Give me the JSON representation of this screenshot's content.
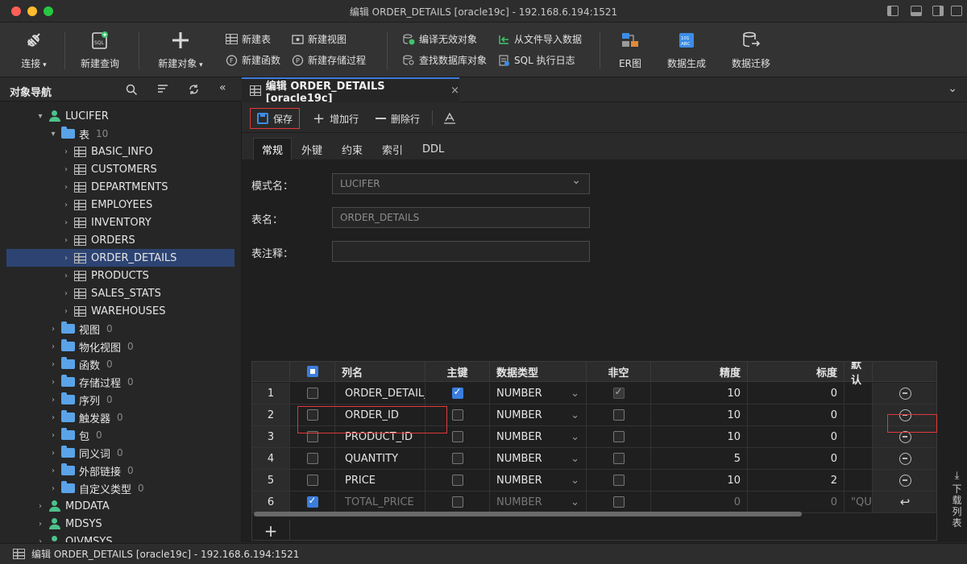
{
  "window": {
    "title": "编辑 ORDER_DETAILS [oracle19c] - 192.168.6.194:1521"
  },
  "toolbar": {
    "connect": "连接",
    "new_query": "新建查询",
    "new_object": "新建对象",
    "new_table": "新建表",
    "new_view": "新建视图",
    "new_function": "新建函数",
    "new_procedure": "新建存储过程",
    "compile_invalid": "编译无效对象",
    "find_db_object": "查找数据库对象",
    "import_from_file": "从文件导入数据",
    "sql_log": "SQL 执行日志",
    "er": "ER图",
    "data_gen": "数据生成",
    "data_migrate": "数据迁移"
  },
  "nav": {
    "title": "对象导航",
    "tree": [
      {
        "label": "LUCIFER",
        "type": "schema",
        "level": 0,
        "expanded": true
      },
      {
        "label": "表",
        "type": "folder",
        "level": 1,
        "count": "10",
        "expanded": true
      },
      {
        "label": "BASIC_INFO",
        "type": "table",
        "level": 2
      },
      {
        "label": "CUSTOMERS",
        "type": "table",
        "level": 2
      },
      {
        "label": "DEPARTMENTS",
        "type": "table",
        "level": 2
      },
      {
        "label": "EMPLOYEES",
        "type": "table",
        "level": 2
      },
      {
        "label": "INVENTORY",
        "type": "table",
        "level": 2
      },
      {
        "label": "ORDERS",
        "type": "table",
        "level": 2
      },
      {
        "label": "ORDER_DETAILS",
        "type": "table",
        "level": 2,
        "selected": true
      },
      {
        "label": "PRODUCTS",
        "type": "table",
        "level": 2
      },
      {
        "label": "SALES_STATS",
        "type": "table",
        "level": 2
      },
      {
        "label": "WAREHOUSES",
        "type": "table",
        "level": 2
      },
      {
        "label": "视图",
        "type": "folder",
        "level": 1,
        "count": "0"
      },
      {
        "label": "物化视图",
        "type": "folder",
        "level": 1,
        "count": "0"
      },
      {
        "label": "函数",
        "type": "folder",
        "level": 1,
        "count": "0"
      },
      {
        "label": "存储过程",
        "type": "folder",
        "level": 1,
        "count": "0"
      },
      {
        "label": "序列",
        "type": "folder",
        "level": 1,
        "count": "0"
      },
      {
        "label": "触发器",
        "type": "folder",
        "level": 1,
        "count": "0"
      },
      {
        "label": "包",
        "type": "folder",
        "level": 1,
        "count": "0"
      },
      {
        "label": "同义词",
        "type": "folder",
        "level": 1,
        "count": "0"
      },
      {
        "label": "外部链接",
        "type": "folder",
        "level": 1,
        "count": "0"
      },
      {
        "label": "自定义类型",
        "type": "folder",
        "level": 1,
        "count": "0"
      },
      {
        "label": "MDDATA",
        "type": "schema",
        "level": 0
      },
      {
        "label": "MDSYS",
        "type": "schema",
        "level": 0
      },
      {
        "label": "OJVMSYS",
        "type": "schema",
        "level": 0
      }
    ]
  },
  "editor": {
    "tab_label": "编辑 ORDER_DETAILS [oracle19c]",
    "save": "保存",
    "add_row": "增加行",
    "delete_row": "删除行",
    "subtabs": [
      "常规",
      "外键",
      "约束",
      "索引",
      "DDL"
    ],
    "form": {
      "schema_label": "模式名：",
      "schema_value": "LUCIFER",
      "table_label": "表名：",
      "table_value": "ORDER_DETAILS",
      "comment_label": "表注释：",
      "comment_value": ""
    },
    "grid": {
      "headers": [
        "列名",
        "主键",
        "数据类型",
        "非空",
        "精度",
        "标度",
        "默认"
      ],
      "rows": [
        {
          "n": "1",
          "name": "ORDER_DETAIL_",
          "pk": true,
          "type": "NUMBER",
          "notnull": true,
          "precision": "10",
          "scale": "0",
          "default": ""
        },
        {
          "n": "2",
          "name": "ORDER_ID",
          "pk": false,
          "type": "NUMBER",
          "notnull": false,
          "precision": "10",
          "scale": "0",
          "default": ""
        },
        {
          "n": "3",
          "name": "PRODUCT_ID",
          "pk": false,
          "type": "NUMBER",
          "notnull": false,
          "precision": "10",
          "scale": "0",
          "default": ""
        },
        {
          "n": "4",
          "name": "QUANTITY",
          "pk": false,
          "type": "NUMBER",
          "notnull": false,
          "precision": "5",
          "scale": "0",
          "default": ""
        },
        {
          "n": "5",
          "name": "PRICE",
          "pk": false,
          "type": "NUMBER",
          "notnull": false,
          "precision": "10",
          "scale": "2",
          "default": ""
        },
        {
          "n": "6",
          "name": "TOTAL_PRICE",
          "pk": false,
          "type": "NUMBER",
          "notnull": false,
          "precision": "0",
          "scale": "0",
          "default": "\"QU",
          "checked": true,
          "deleted": true
        }
      ]
    },
    "side_panel": "下载列表"
  },
  "statusbar": {
    "text": "编辑 ORDER_DETAILS [oracle19c] - 192.168.6.194:1521"
  },
  "colors": {
    "accent": "#3b7ddd",
    "highlight": "#e03a3a",
    "selection": "#2d4473"
  }
}
